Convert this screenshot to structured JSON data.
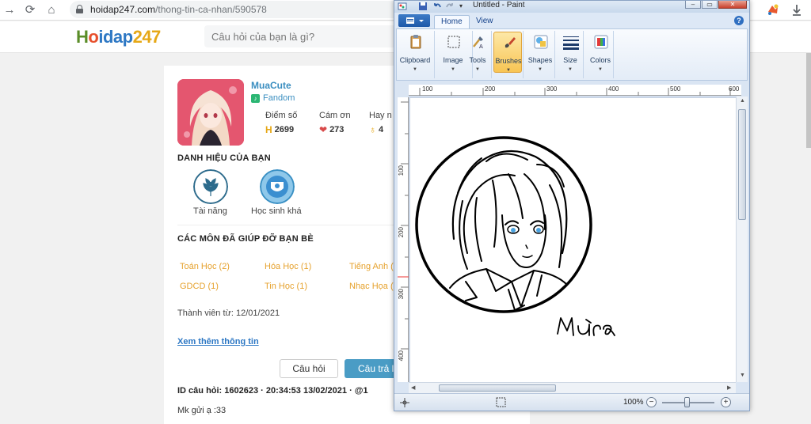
{
  "browser": {
    "url_domain": "hoidap247.com",
    "url_path": "/thong-tin-ca-nhan/590578"
  },
  "site": {
    "logo_parts": [
      "H",
      "o",
      "idap",
      "247"
    ],
    "search_placeholder": "Câu hỏi của bạn là gì?"
  },
  "profile": {
    "username": "MuaCute",
    "group": "Fandom",
    "stats": [
      {
        "label": "Điểm số",
        "value": "2699"
      },
      {
        "label": "Cám ơn",
        "value": "273"
      },
      {
        "label": "Hay n",
        "value": "4"
      }
    ],
    "titles_heading": "DANH HIỆU CỦA BẠN",
    "badges": [
      {
        "label": "Tài năng"
      },
      {
        "label": "Học sinh khá"
      }
    ],
    "subjects_heading": "CÁC MÔN ĐÃ GIÚP ĐỠ BẠN BÈ",
    "subjects": [
      "Toán Học (2)",
      "Hóa Học (1)",
      "Tiếng Anh (",
      "GDCD (1)",
      "Tin Học (1)",
      "Nhạc Họa ("
    ],
    "member_since": "Thành viên từ: 12/01/2021",
    "more_info": "Xem thêm thông tin",
    "ask_button": "Câu hỏi",
    "answer_button": "Câu trả l",
    "question_meta": "ID câu hỏi: 1602623  ·  20:34:53 13/02/2021  ·  @1",
    "question_text": "Mk gửi ạ :33"
  },
  "paint": {
    "window_title": "Untitled - Paint",
    "tabs": [
      "Home",
      "View"
    ],
    "tools": [
      {
        "label": "Clipboard",
        "icon": "clipboard-icon"
      },
      {
        "label": "Image",
        "icon": "image-select-icon"
      },
      {
        "label": "Tools",
        "icon": "tools-icon"
      },
      {
        "label": "Brushes",
        "icon": "brush-icon",
        "selected": true
      },
      {
        "label": "Shapes",
        "icon": "shapes-icon"
      },
      {
        "label": "Size",
        "icon": "size-lines-icon"
      },
      {
        "label": "Colors",
        "icon": "colors-icon"
      }
    ],
    "ruler_h": [
      "100",
      "200",
      "300",
      "400",
      "500",
      "600"
    ],
    "ruler_v": [
      "100",
      "200",
      "300",
      "400"
    ],
    "signature": "Mưa",
    "zoom": "100%"
  },
  "colors": {
    "accent_blue": "#4a9cc5",
    "link_blue": "#2e78c4",
    "subject_orange": "#e6a22e",
    "ribbon_selected": "#f8c554"
  }
}
